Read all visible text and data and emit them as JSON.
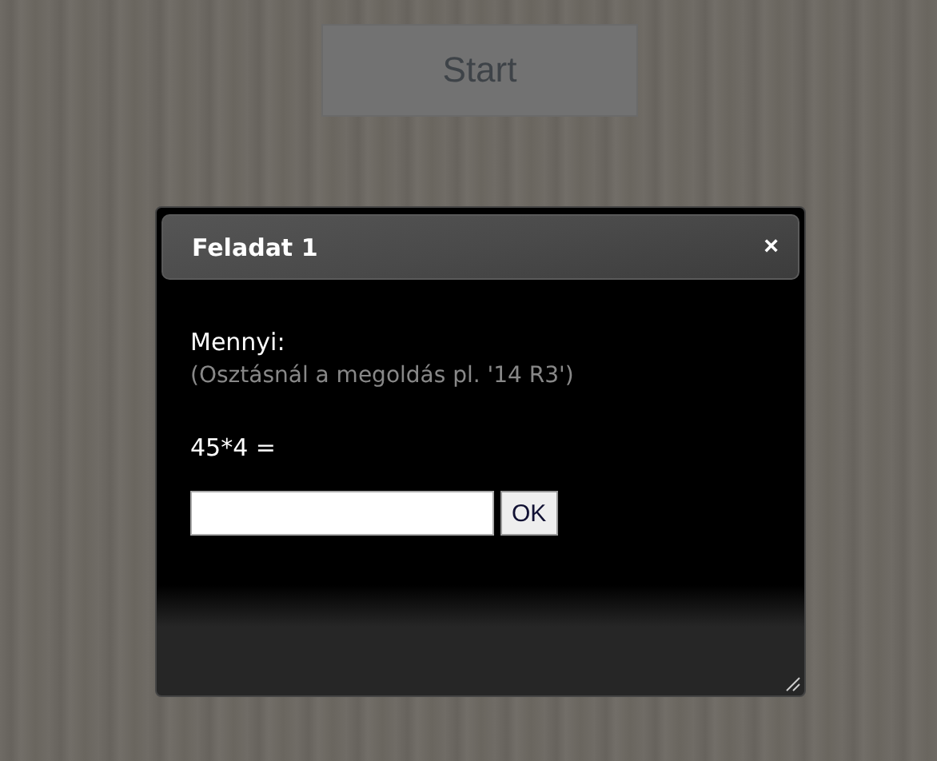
{
  "start_button": {
    "label": "Start",
    "disabled": true
  },
  "dialog": {
    "title": "Feladat 1",
    "close": "×",
    "prompt": "Mennyi:",
    "hint": "(Osztásnál a megoldás pl. '14 R3')",
    "question": "45*4 =",
    "ok_button": "OK"
  }
}
